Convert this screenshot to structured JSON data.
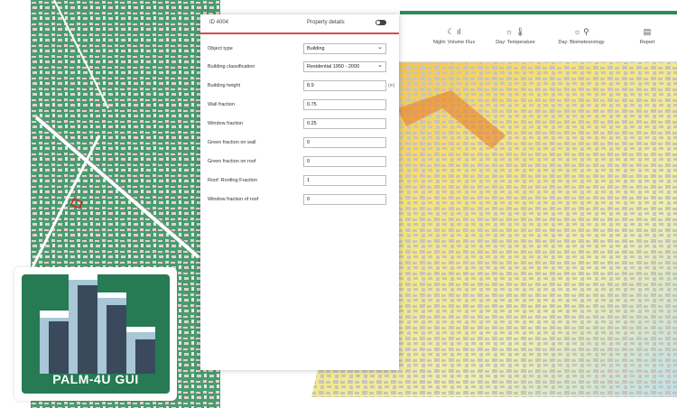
{
  "panel": {
    "object_id": "ID 4004",
    "title": "Property details",
    "rows": [
      {
        "label": "Object type",
        "value": "Building",
        "select": true
      },
      {
        "label": "Building classification",
        "value": "Residential 1950 - 2000",
        "select": true
      },
      {
        "label": "Building height",
        "value": "8.9",
        "unit": "(m)"
      },
      {
        "label": "Wall fraction",
        "value": "0.75"
      },
      {
        "label": "Window fraction",
        "value": "0.25"
      },
      {
        "label": "Green fraction on wall",
        "value": "0"
      },
      {
        "label": "Green fraction on roof",
        "value": "0"
      },
      {
        "label": "Roof: Roofing Fraction",
        "value": "1"
      },
      {
        "label": "Window fraction of roof",
        "value": "0"
      }
    ]
  },
  "toolbar": {
    "items": [
      {
        "label": "Night: Volume Flux",
        "icon": "moon-bar-icon",
        "glyph": "☾ ıl"
      },
      {
        "label": "Day: Temperature",
        "icon": "sun-thermometer-icon",
        "glyph": "☼ 🌡"
      },
      {
        "label": "Day: Biometeorology",
        "icon": "sun-person-icon",
        "glyph": "☼ ⚲"
      },
      {
        "label": "Report",
        "icon": "report-icon",
        "glyph": "▤"
      }
    ]
  },
  "logo": {
    "text": "PALM-4U GUI",
    "bars_color": "#3a4a5c",
    "light_color": "#a9c7d6",
    "bg_color": "#267a54"
  },
  "colors": {
    "accent_red": "#d05050",
    "map_green": "#2e8b57"
  }
}
